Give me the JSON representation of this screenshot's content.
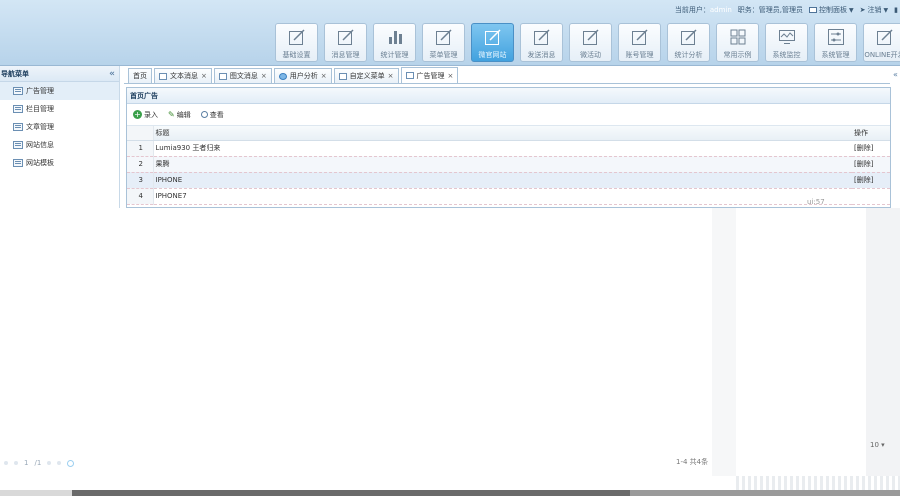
{
  "header": {
    "current_user_label": "当前用户：",
    "current_user": "admin",
    "role_label": "职务：",
    "role": "管理员,管理员",
    "control_panel": "控制面板",
    "logout": "注销"
  },
  "toolbar": [
    {
      "label": "基础设置",
      "icon": "edit-icon"
    },
    {
      "label": "消息管理",
      "icon": "edit-icon"
    },
    {
      "label": "统计管理",
      "icon": "bar-chart-icon"
    },
    {
      "label": "菜单管理",
      "icon": "edit-icon"
    },
    {
      "label": "微官网站",
      "icon": "edit-icon",
      "active": true
    },
    {
      "label": "发送消息",
      "icon": "edit-icon"
    },
    {
      "label": "微活动",
      "icon": "edit-icon"
    },
    {
      "label": "账号管理",
      "icon": "edit-icon"
    },
    {
      "label": "统计分析",
      "icon": "edit-icon"
    },
    {
      "label": "常用示例",
      "icon": "grid-icon"
    },
    {
      "label": "系统监控",
      "icon": "monitor-icon"
    },
    {
      "label": "系统管理",
      "icon": "sliders-icon"
    },
    {
      "label": "ONLINE开发",
      "icon": "edit-icon"
    }
  ],
  "nav": {
    "title": "导航菜单",
    "collapse": "«",
    "items": [
      {
        "label": "广告管理",
        "selected": true
      },
      {
        "label": "栏目管理"
      },
      {
        "label": "文章管理"
      },
      {
        "label": "网站信息"
      },
      {
        "label": "网站模板"
      }
    ]
  },
  "tabs": [
    {
      "label": "首页"
    },
    {
      "label": "文本消息"
    },
    {
      "label": "图文消息"
    },
    {
      "label": "用户分析"
    },
    {
      "label": "自定义菜单"
    },
    {
      "label": "广告管理",
      "active": true
    }
  ],
  "panel": {
    "title": "首页广告",
    "add": "录入",
    "edit": "编辑",
    "view": "查看",
    "col_title": "标题",
    "col_op": "操作",
    "rows": [
      {
        "num": "1",
        "title": "Lumia930 王者归来",
        "op": "[删除]"
      },
      {
        "num": "2",
        "title": "果腾",
        "op": "[删除]"
      },
      {
        "num": "3",
        "title": "IPHONE",
        "op": "[删除]"
      },
      {
        "num": "4",
        "title": "IPHONE7",
        "op": ""
      }
    ],
    "extra": "ui:57"
  },
  "pager": {
    "page": "1",
    "of": "/1",
    "total": "1-4 共4条",
    "size": "10"
  }
}
